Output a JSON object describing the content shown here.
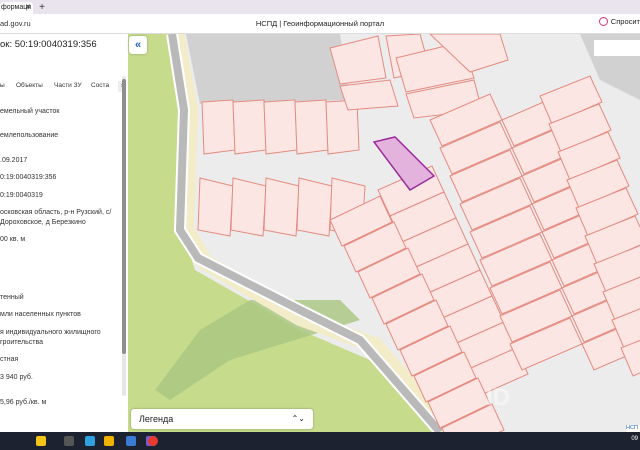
{
  "browser": {
    "tab_title": "формаци",
    "new_tab_symbol": "+",
    "close_symbol": "✕",
    "url": "ad.gov.ru",
    "page_title": "НСПД | Геоинформационный портал",
    "ask_label": "Спросит"
  },
  "panel": {
    "title": "ок: 50:19:0040319:356",
    "tabs": [
      {
        "label": "ы"
      },
      {
        "label": "Объекты"
      },
      {
        "label": "Части ЗУ"
      },
      {
        "label": "Соста"
      },
      {
        "label": "›"
      }
    ],
    "fields": [
      {
        "text": "емельный участок"
      },
      {
        "text": "емлепользование"
      },
      {
        "text": ".09.2017"
      },
      {
        "text": "0:19:0040319:356"
      },
      {
        "text": "0:19:0040319"
      },
      {
        "text": "осковская область, р-н Рузский, с/ Дороховское, д Березкино"
      },
      {
        "text": "00 кв. м"
      },
      {
        "text": "тенный"
      },
      {
        "text": "мли населенных пунктов"
      },
      {
        "text": "я индивидуального жилищного гроительства"
      },
      {
        "text": "стная"
      },
      {
        "text": "3 940 руб."
      },
      {
        "text": "5,96 руб./кв. м"
      }
    ]
  },
  "map": {
    "collapse_symbol": "«",
    "legend_label": "Легенда",
    "legend_toggle": "⌃⌄",
    "badge": "НСП",
    "colors": {
      "parcel_fill": "#fbe6e3",
      "parcel_stroke": "#e58a80",
      "selected_fill": "#e3b3de",
      "selected_stroke": "#9b2c9b",
      "forest": "#c6dc8c",
      "road": "#b9b9b9",
      "road_edge": "#ffffff",
      "sand": "#f2ecc8",
      "background": "#ececec",
      "building": "#d1d1d1"
    }
  },
  "taskbar": {
    "icons": [
      "sparkle-icon",
      "search-icon",
      "edge-icon",
      "folder-icon",
      "store-icon",
      "media-icon",
      "yandex-browser-icon"
    ],
    "clock": "09"
  }
}
